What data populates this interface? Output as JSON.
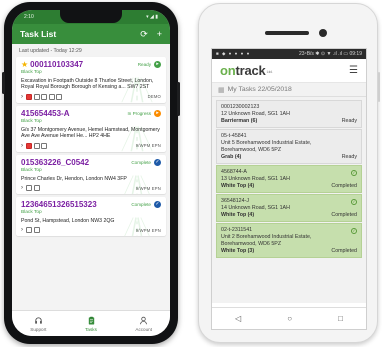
{
  "left_app": {
    "status_time": "2:10",
    "status_icons": "▾ ◢ ▮",
    "title": "Task List",
    "refresh_icon": "refresh-icon",
    "add_icon": "plus-icon",
    "last_updated": "Last updated - Today 12:29",
    "tasks": [
      {
        "id": "000110103347",
        "type": "Black Top",
        "status": "Ready",
        "status_color": "#43a047",
        "starred": true,
        "address": "Excavation in Footpath Outside 8 Thurloe Street, London, Royal Royal Borough Borough of Kensing a... SW7 2ST",
        "code": "DEMO"
      },
      {
        "id": "415654453-A",
        "type": "Black Top",
        "status": "In Progress",
        "status_color": "#fb8c00",
        "starred": false,
        "address": "G/s 37 Montgomery Avenue, Hemel Hamstead, Montgomery Ave Ave Avenue Hemel He... HP2 4HE",
        "code": "9/WPM EPN"
      },
      {
        "id": "015363226_C0542",
        "type": "Black Top",
        "status": "Complete",
        "status_color": "#1e5aa8",
        "starred": false,
        "address": "Prince Charles Dr, Hendon, London NW4 3FP",
        "code": "9/WPM EPN"
      },
      {
        "id": "12364651326515323",
        "type": "Black Top",
        "status": "Complete",
        "status_color": "#1e5aa8",
        "starred": false,
        "address": "Pond St, Hampstead, London NW3 2QG",
        "code": "9/WPM EPN"
      }
    ],
    "nav": [
      {
        "label": "Support",
        "icon": "headset-icon"
      },
      {
        "label": "Tasks",
        "icon": "clipboard-icon"
      },
      {
        "label": "Account",
        "icon": "person-icon"
      }
    ]
  },
  "right_app": {
    "status_left": "■ ◆ ● ● ● ●",
    "status_right": "23⁴B/s ✱ ⊙ ▼ .ıl .ıl ▭ 09:19",
    "logo_on": "on",
    "logo_rest": "track",
    "logo_ltd": "Ltd.",
    "tasks_title": "My Tasks 22/05/2018",
    "tasks": [
      {
        "ref": "0001230002123",
        "address": [
          "12 Unknown Road, SG1 1AH"
        ],
        "work": "Barrierman (6)",
        "status": "Ready",
        "done": false
      },
      {
        "ref": "05-t-45841",
        "address": [
          "Unit 5 Borehamwood Industrial Estate,",
          "Borehamwood, WD6 5PZ"
        ],
        "work": "Grab (4)",
        "status": "Ready",
        "done": false
      },
      {
        "ref": "4568744-A",
        "address": [
          "13 Unknown Road, SG1 1AH"
        ],
        "work": "White Top (4)",
        "status": "Completed",
        "done": true
      },
      {
        "ref": "36548124-J",
        "address": [
          "14 Unknown Road, SG1 1AH"
        ],
        "work": "White Top (4)",
        "status": "Completed",
        "done": true
      },
      {
        "ref": "02-t-2311541",
        "address": [
          "Unit 2 Borehamwood Industrial Estate,",
          "Borehamwood, WD6 5PZ"
        ],
        "work": "White Top (3)",
        "status": "Completed",
        "done": true
      }
    ],
    "nav": [
      "◁",
      "○",
      "□"
    ]
  }
}
